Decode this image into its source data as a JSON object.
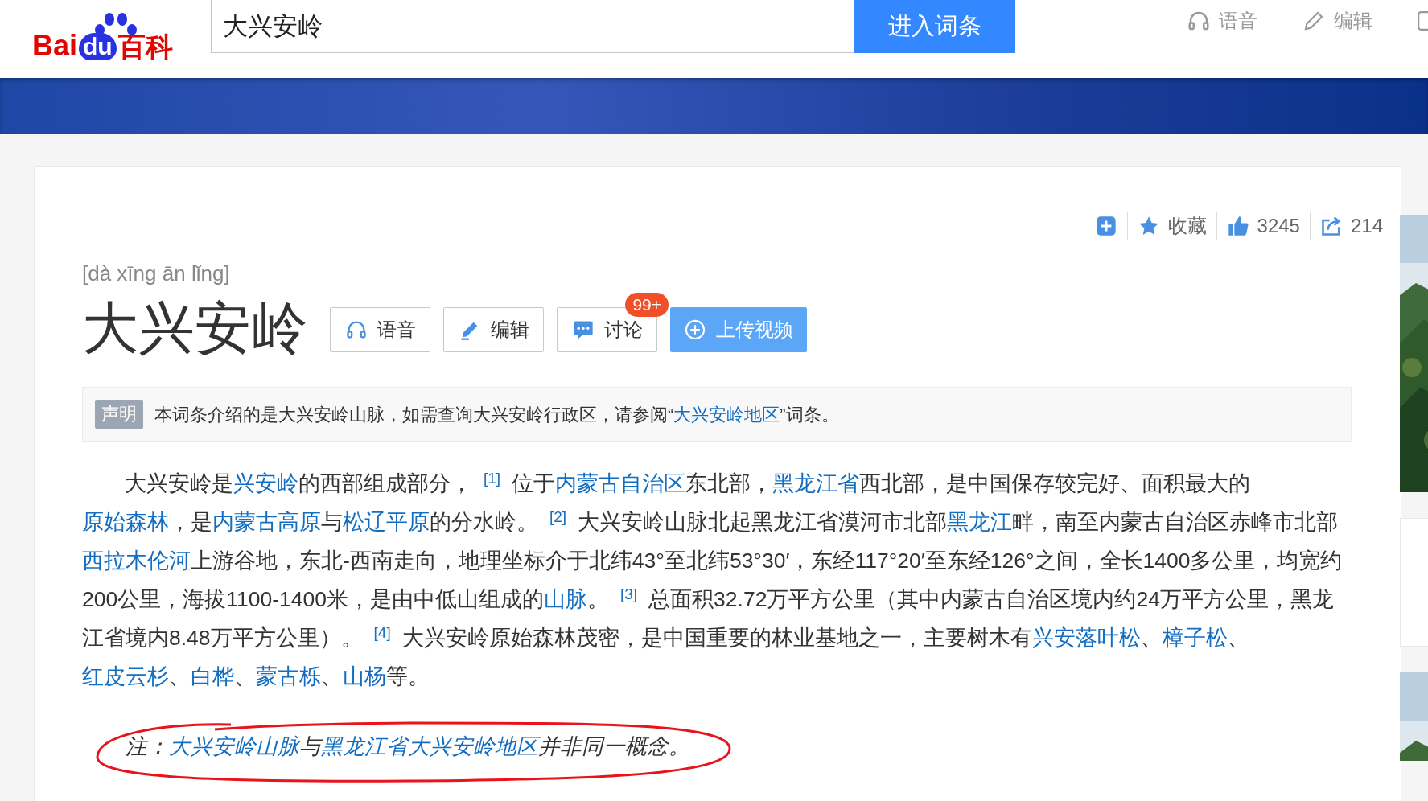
{
  "header": {
    "logo": {
      "part_1": "Bai",
      "part_2": "du",
      "part_3": "百科"
    },
    "search": {
      "value": "大兴安岭"
    },
    "search_button": "进入词条",
    "nav": [
      {
        "kind": "audio",
        "label": "语音"
      },
      {
        "kind": "edit",
        "label": "编辑"
      },
      {
        "kind": "partial"
      }
    ]
  },
  "actions": [
    {
      "kind": "add"
    },
    {
      "kind": "star",
      "label": "收藏"
    },
    {
      "kind": "like",
      "label": "3245"
    },
    {
      "kind": "share",
      "label": "214"
    }
  ],
  "pinyin": "[dà xīng ān lǐng]",
  "title": "大兴安岭",
  "title_buttons": [
    {
      "kind": "audio",
      "label": "语音",
      "primary": false
    },
    {
      "kind": "edit",
      "label": "编辑",
      "primary": false
    },
    {
      "kind": "discuss",
      "label": "讨论",
      "primary": false,
      "badge": "99+"
    },
    {
      "kind": "upload",
      "label": "上传视频",
      "primary": true
    }
  ],
  "notice": {
    "tag": "声明",
    "segments": [
      {
        "kind": "text",
        "text": "本词条介绍的是大兴安岭山脉，如需查询大兴安岭行政区，请参阅“"
      },
      {
        "kind": "link",
        "text": "大兴安岭地区"
      },
      {
        "kind": "text",
        "text": "”词条。"
      }
    ]
  },
  "paragraph": [
    {
      "kind": "text",
      "text": "大兴安岭是"
    },
    {
      "kind": "link",
      "text": "兴安岭"
    },
    {
      "kind": "text",
      "text": "的西部组成部分，"
    },
    {
      "kind": "ref",
      "text": "[1]"
    },
    {
      "kind": "text",
      "text": "位于"
    },
    {
      "kind": "link",
      "text": "内蒙古自治区"
    },
    {
      "kind": "text",
      "text": "东北部，"
    },
    {
      "kind": "link",
      "text": "黑龙江省"
    },
    {
      "kind": "text",
      "text": "西北部，是中国保存较完好、面积最大的"
    },
    {
      "kind": "link",
      "text": "原始森林"
    },
    {
      "kind": "text",
      "text": "，是"
    },
    {
      "kind": "link",
      "text": "内蒙古高原"
    },
    {
      "kind": "text",
      "text": "与"
    },
    {
      "kind": "link",
      "text": "松辽平原"
    },
    {
      "kind": "text",
      "text": "的分水岭。"
    },
    {
      "kind": "ref",
      "text": "[2]"
    },
    {
      "kind": "text",
      "text": "大兴安岭山脉北起黑龙江省漠河市北部"
    },
    {
      "kind": "link",
      "text": "黑龙江"
    },
    {
      "kind": "text",
      "text": "畔，南至内蒙古自治区赤峰市北部"
    },
    {
      "kind": "link",
      "text": "西拉木伦河"
    },
    {
      "kind": "text",
      "text": "上游谷地，东北-西南走向，地理坐标介于北纬43°至北纬53°30′，东经117°20′至东经126°之间，全长1400多公里，均宽约200公里，海拔1100-1400米，是由中低山组成的"
    },
    {
      "kind": "link",
      "text": "山脉"
    },
    {
      "kind": "text",
      "text": "。"
    },
    {
      "kind": "ref",
      "text": "[3]"
    },
    {
      "kind": "text",
      "text": "总面积32.72万平方公里（其中内蒙古自治区境内约24万平方公里，黑龙江省境内8.48万平方公里）。"
    },
    {
      "kind": "ref",
      "text": "[4]"
    },
    {
      "kind": "text",
      "text": "大兴安岭原始森林茂密，是中国重要的林业基地之一，主要树木有"
    },
    {
      "kind": "link",
      "text": "兴安落叶松"
    },
    {
      "kind": "text",
      "text": "、"
    },
    {
      "kind": "link",
      "text": "樟子松"
    },
    {
      "kind": "text",
      "text": "、"
    },
    {
      "kind": "link",
      "text": "红皮云杉"
    },
    {
      "kind": "text",
      "text": "、"
    },
    {
      "kind": "link",
      "text": "白桦"
    },
    {
      "kind": "text",
      "text": "、"
    },
    {
      "kind": "link",
      "text": "蒙古栎"
    },
    {
      "kind": "text",
      "text": "、"
    },
    {
      "kind": "link",
      "text": "山杨"
    },
    {
      "kind": "text",
      "text": "等。"
    }
  ],
  "note": [
    {
      "kind": "text",
      "text": "注："
    },
    {
      "kind": "link",
      "text": "大兴安岭山脉"
    },
    {
      "kind": "text",
      "text": "与"
    },
    {
      "kind": "link",
      "text": "黑龙江省大兴安岭地区"
    },
    {
      "kind": "text",
      "text": "并非同一概念。"
    }
  ],
  "sidebar": [
    {
      "kind": "picture"
    },
    {
      "kind": "card"
    },
    {
      "kind": "picture"
    }
  ]
}
